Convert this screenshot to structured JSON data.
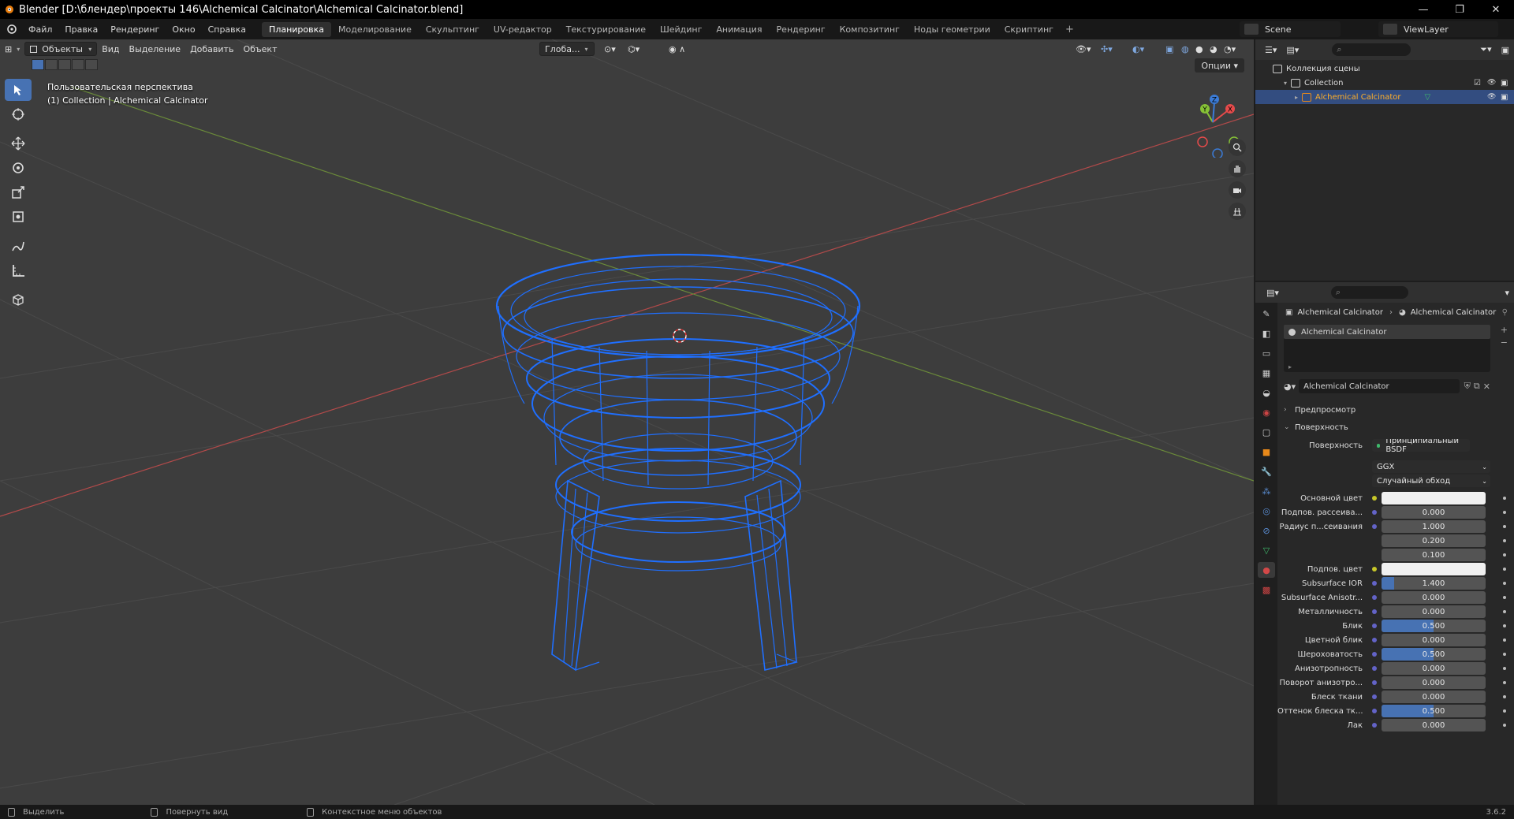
{
  "window": {
    "title": "Blender [D:\\блендер\\проекты 146\\Alchemical Calcinator\\Alchemical Calcinator.blend]",
    "minimize": "—",
    "maximize": "❐",
    "close": "✕"
  },
  "menu": {
    "items": [
      "Файл",
      "Правка",
      "Рендеринг",
      "Окно",
      "Справка"
    ],
    "workspaces": [
      {
        "label": "Планировка",
        "active": true
      },
      {
        "label": "Моделирование",
        "active": false
      },
      {
        "label": "Скульптинг",
        "active": false
      },
      {
        "label": "UV-редактор",
        "active": false
      },
      {
        "label": "Текстурирование",
        "active": false
      },
      {
        "label": "Шейдинг",
        "active": false
      },
      {
        "label": "Анимация",
        "active": false
      },
      {
        "label": "Рендеринг",
        "active": false
      },
      {
        "label": "Композитинг",
        "active": false
      },
      {
        "label": "Ноды геометрии",
        "active": false
      },
      {
        "label": "Скриптинг",
        "active": false
      }
    ],
    "add_tab": "+",
    "scene": "Scene",
    "view_layer": "ViewLayer"
  },
  "viewport": {
    "mode": "Объекты",
    "menus": [
      "Вид",
      "Выделение",
      "Добавить",
      "Объект"
    ],
    "orientation": "Глоба...",
    "options": "Опции",
    "info_line1": "Пользовательская перспектива",
    "info_line2": "(1) Collection | Alchemical Calcinator",
    "gizmo": {
      "x": "X",
      "y": "Y",
      "z": "Z"
    },
    "wire_color": "#1f6fff",
    "bg_color": "#3d3d3d"
  },
  "outliner": {
    "rows": [
      {
        "label": "Коллекция сцены",
        "indent": 0,
        "selected": false
      },
      {
        "label": "Collection",
        "indent": 1,
        "selected": false
      },
      {
        "label": "Alchemical Calcinator",
        "indent": 2,
        "selected": true
      }
    ]
  },
  "properties": {
    "breadcrumb_object": "Alchemical Calcinator",
    "breadcrumb_material": "Alchemical Calcinator",
    "slot": "Alchemical Calcinator",
    "material_name": "Alchemical Calcinator",
    "panel_preview": "Предпросмотр",
    "panel_surface": "Поверхность",
    "surface_label": "Поверхность",
    "surface_shader": "Принципиальный BSDF",
    "distribution": "GGX",
    "subsurface_method": "Случайный обход",
    "fields": [
      {
        "label": "Основной цвет",
        "value": "",
        "kind": "white",
        "fill": 0
      },
      {
        "label": "Подпов. рассеива...",
        "value": "0.000",
        "kind": "num",
        "fill": 0
      },
      {
        "label": "Радиус п...сеивания",
        "value": "1.000",
        "kind": "num",
        "fill": 0
      },
      {
        "label": "",
        "value": "0.200",
        "kind": "num",
        "fill": 0
      },
      {
        "label": "",
        "value": "0.100",
        "kind": "num",
        "fill": 0
      },
      {
        "label": "Подпов. цвет",
        "value": "",
        "kind": "white",
        "fill": 0
      },
      {
        "label": "Subsurface IOR",
        "value": "1.400",
        "kind": "num",
        "fill": 0.12
      },
      {
        "label": "Subsurface Anisotr...",
        "value": "0.000",
        "kind": "num",
        "fill": 0
      },
      {
        "label": "Металличность",
        "value": "0.000",
        "kind": "num",
        "fill": 0
      },
      {
        "label": "Блик",
        "value": "0.500",
        "kind": "num",
        "fill": 0.5
      },
      {
        "label": "Цветной блик",
        "value": "0.000",
        "kind": "num",
        "fill": 0
      },
      {
        "label": "Шероховатость",
        "value": "0.500",
        "kind": "num",
        "fill": 0.5
      },
      {
        "label": "Анизотропность",
        "value": "0.000",
        "kind": "num",
        "fill": 0
      },
      {
        "label": "Поворот анизотро...",
        "value": "0.000",
        "kind": "num",
        "fill": 0
      },
      {
        "label": "Блеск ткани",
        "value": "0.000",
        "kind": "num",
        "fill": 0
      },
      {
        "label": "Оттенок блеска тк...",
        "value": "0.500",
        "kind": "num",
        "fill": 0.5
      },
      {
        "label": "Лак",
        "value": "0.000",
        "kind": "num",
        "fill": 0
      }
    ]
  },
  "status": {
    "select": "Выделить",
    "rotate": "Повернуть вид",
    "context": "Контекстное меню объектов",
    "version": "3.6.2"
  }
}
